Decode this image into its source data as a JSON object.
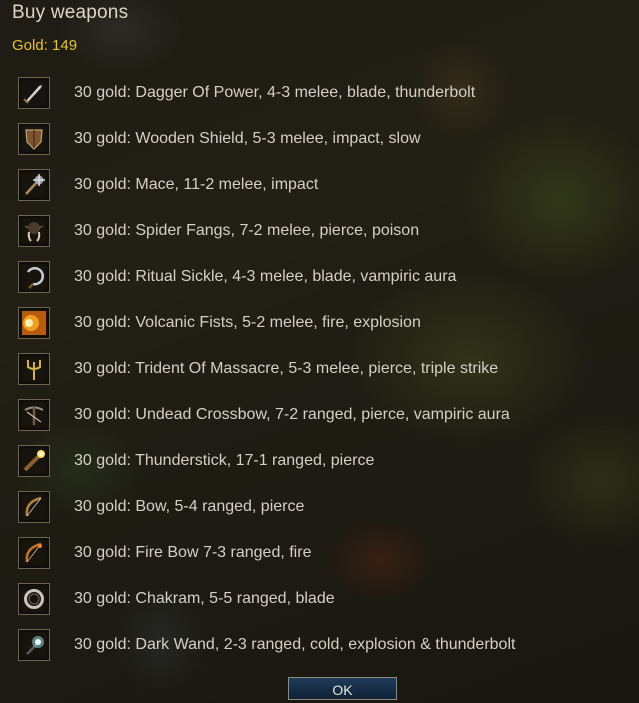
{
  "dialog": {
    "title": "Buy weapons",
    "gold": "Gold: 149",
    "ok_label": "OK"
  },
  "items": [
    {
      "label": "30 gold: Dagger Of Power, 4-3 melee, blade, thunderbolt",
      "icon": "dagger-icon"
    },
    {
      "label": "30 gold: Wooden Shield, 5-3 melee, impact, slow",
      "icon": "shield-icon"
    },
    {
      "label": "30 gold: Mace, 11-2 melee, impact",
      "icon": "mace-icon"
    },
    {
      "label": "30 gold: Spider Fangs, 7-2 melee, pierce, poison",
      "icon": "fangs-icon"
    },
    {
      "label": "30 gold: Ritual Sickle, 4-3 melee, blade, vampiric aura",
      "icon": "sickle-icon"
    },
    {
      "label": "30 gold: Volcanic Fists, 5-2 melee, fire, explosion",
      "icon": "fire-fist-icon"
    },
    {
      "label": "30 gold: Trident Of Massacre, 5-3 melee, pierce, triple strike",
      "icon": "trident-icon"
    },
    {
      "label": "30 gold: Undead Crossbow, 7-2 ranged, pierce, vampiric aura",
      "icon": "crossbow-icon"
    },
    {
      "label": "30 gold: Thunderstick, 17-1 ranged, pierce",
      "icon": "thunderstick-icon"
    },
    {
      "label": "30 gold: Bow, 5-4 ranged, pierce",
      "icon": "bow-icon"
    },
    {
      "label": "30 gold: Fire Bow 7-3 ranged, fire",
      "icon": "fire-bow-icon"
    },
    {
      "label": "30 gold: Chakram, 5-5 ranged, blade",
      "icon": "chakram-icon"
    },
    {
      "label": "30 gold: Dark Wand, 2-3 ranged, cold, explosion & thunderbolt",
      "icon": "wand-icon"
    }
  ]
}
